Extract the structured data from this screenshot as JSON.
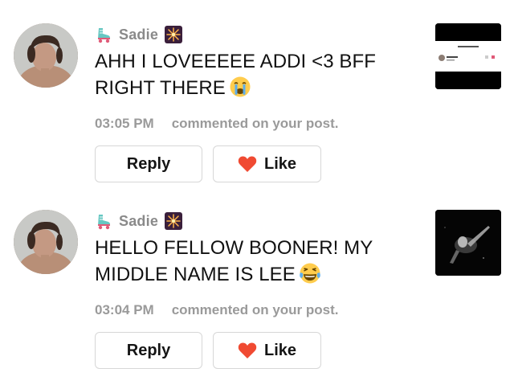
{
  "notifications": [
    {
      "username": "Sadie",
      "prefix_icon": "roller-skate-icon",
      "suffix_icon": "fireworks-icon",
      "comment": "AHH I LOVEEEEE ADDI <3 BFF RIGHT THERE",
      "comment_emoji": "crying-face-icon",
      "time": "03:05 PM",
      "action": "commented on your post.",
      "reply_label": "Reply",
      "like_label": "Like",
      "thumbnail": "post-screenshot-thumbnail"
    },
    {
      "username": "Sadie",
      "prefix_icon": "roller-skate-icon",
      "suffix_icon": "fireworks-icon",
      "comment": "HELLO FELLOW BOONER! MY MIDDLE NAME IS LEE",
      "comment_emoji": "laughing-tears-icon",
      "time": "03:04 PM",
      "action": "commented on your post.",
      "reply_label": "Reply",
      "like_label": "Like",
      "thumbnail": "dark-photo-thumbnail"
    }
  ],
  "colors": {
    "heart": "#f04a32",
    "muted_text": "#8a8a8a",
    "button_border": "#d7d7d7"
  }
}
